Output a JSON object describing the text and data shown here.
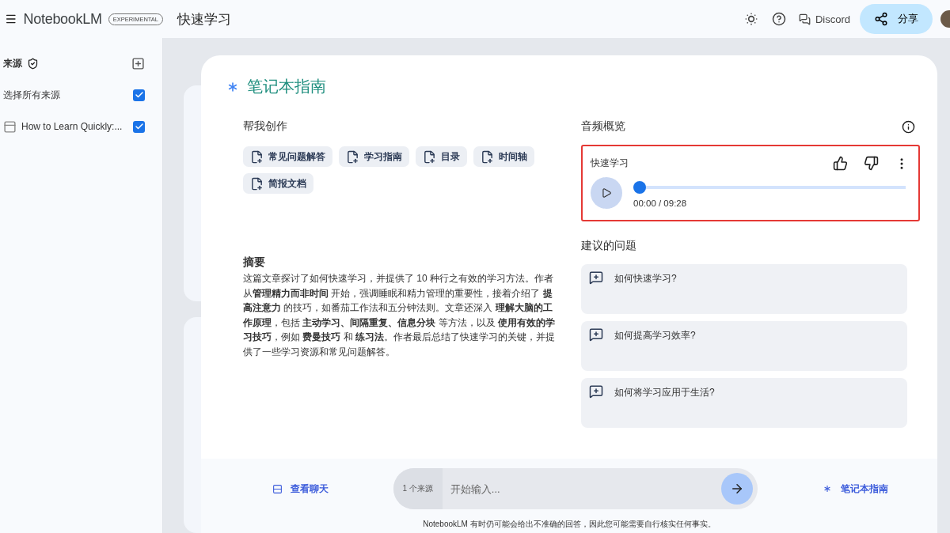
{
  "header": {
    "app_name": "NotebookLM",
    "badge": "EXPERIMENTAL",
    "notebook_title": "快速学习",
    "discord": "Discord",
    "share": "分享"
  },
  "sidebar": {
    "title": "来源",
    "select_all": {
      "label": "选择所有来源",
      "checked": true
    },
    "sources": [
      {
        "label": "How to Learn Quickly:...",
        "checked": true
      }
    ]
  },
  "guide": {
    "title": "笔记本指南",
    "create_heading": "帮我创作",
    "create_buttons": [
      "常见问题解答",
      "学习指南",
      "目录",
      "时间轴",
      "简报文档"
    ],
    "summary_heading": "摘要",
    "summary": "这篇文章探讨了如何快速学习，并提供了 10 种行之有效的学习方法。作者从**管理精力而非时间** 开始，强调睡眠和精力管理的重要性，接着介绍了 **提高注意力** 的技巧，如番茄工作法和五分钟法则。文章还深入 **理解大脑的工作原理**，包括 **主动学习、间隔重复、信息分块** 等方法，以及 **使用有效的学习技巧**，例如 **费曼技巧** 和 **练习法**。作者最后总结了快速学习的关键，并提供了一些学习资源和常见问题解答。",
    "audio_heading": "音频概览",
    "audio": {
      "title": "快速学习",
      "highlighted": true,
      "level": 0,
      "time": "00:00 / 09:28"
    },
    "questions_heading": "建议的问题",
    "questions": [
      "如何快速学习?",
      "如何提高学习效率?",
      "如何将学习应用于生活?"
    ]
  },
  "footer": {
    "view_chat": "查看聊天",
    "source_count": "1 个来源",
    "input_placeholder": "开始输入...",
    "guide_button": "笔记本指南",
    "disclaimer": "NotebookLM 有时仍可能会给出不准确的回答，因此您可能需要自行核实任何事实。"
  }
}
